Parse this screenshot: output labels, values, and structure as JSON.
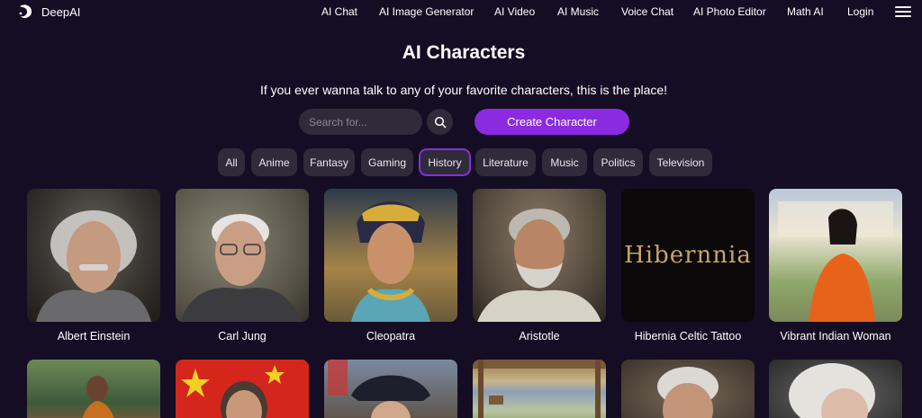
{
  "header": {
    "logo_text": "DeepAI",
    "nav": [
      "AI Chat",
      "AI Image Generator",
      "AI Video",
      "AI Music",
      "Voice Chat",
      "AI Photo Editor",
      "Math AI",
      "Login"
    ]
  },
  "main": {
    "title": "AI Characters",
    "subtitle": "If you ever wanna talk to any of your favorite characters, this is the place!",
    "search_placeholder": "Search for...",
    "create_label": "Create Character",
    "categories": [
      "All",
      "Anime",
      "Fantasy",
      "Gaming",
      "History",
      "Literature",
      "Music",
      "Politics",
      "Television"
    ],
    "active_category": "History"
  },
  "characters": [
    {
      "name": "Albert Einstein"
    },
    {
      "name": "Carl Jung"
    },
    {
      "name": "Cleopatra"
    },
    {
      "name": "Aristotle"
    },
    {
      "name": "Hibernia Celtic Tattoo",
      "logo_text": "Hibernnia"
    },
    {
      "name": "Vibrant Indian Woman"
    }
  ],
  "colors": {
    "background": "#150d24",
    "accent": "#8a2be2",
    "chip": "#2f2b3a"
  }
}
